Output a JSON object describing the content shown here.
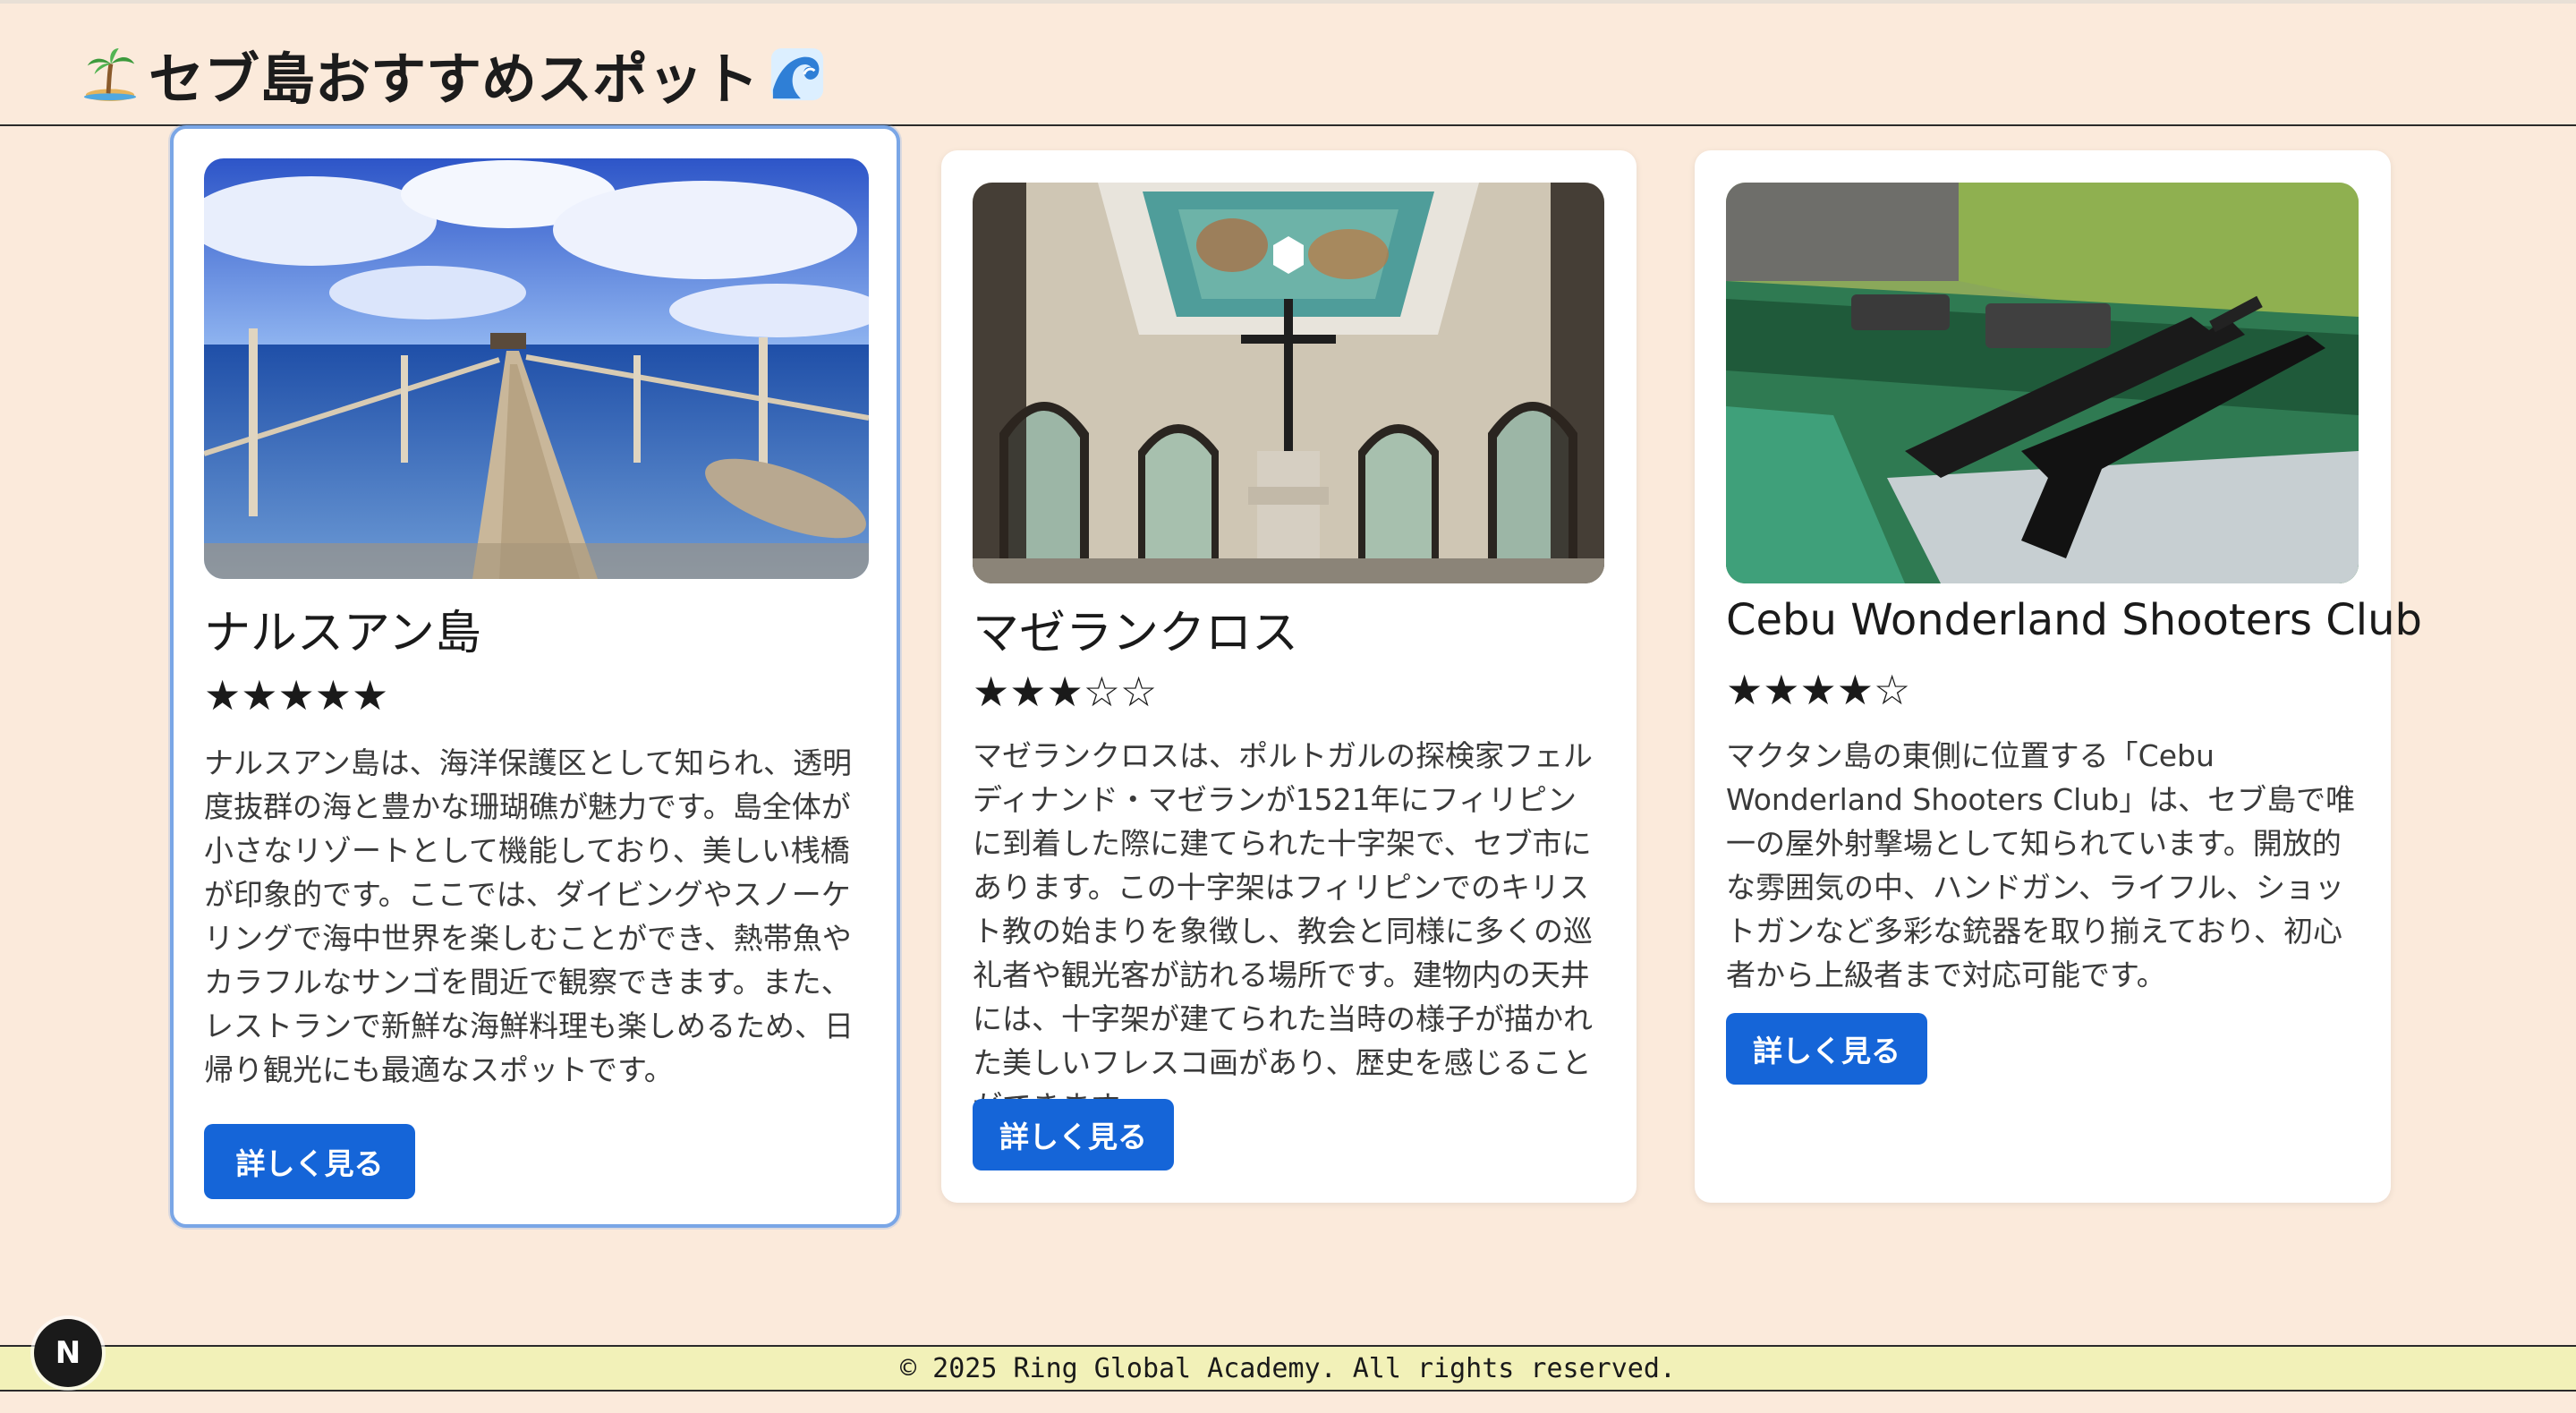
{
  "header": {
    "title": "セブ島おすすめスポット",
    "leading_icon": "palm-island-icon",
    "trailing_icon": "wave-icon"
  },
  "spots": [
    {
      "title": "ナルスアン島",
      "stars": "★★★★★",
      "rating": 5,
      "image_icon": "wooden-pier-photo",
      "description": "ナルスアン島は、海洋保護区として知られ、透明度抜群の海と豊かな珊瑚礁が魅力です。島全体が小さなリゾートとして機能しており、美しい桟橋が印象的です。ここでは、ダイビングやスノーケリングで海中世界を楽しむことができ、熱帯魚やカラフルなサンゴを間近で観察できます。また、レストランで新鮮な海鮮料理も楽しめるため、日帰り観光にも最適なスポットです。",
      "button_label": "詳しく見る"
    },
    {
      "title": "マゼランクロス",
      "stars": "★★★☆☆",
      "rating": 3,
      "image_icon": "magellan-cross-photo",
      "description": "マゼランクロスは、ポルトガルの探検家フェルディナンド・マゼランが1521年にフィリピンに到着した際に建てられた十字架で、セブ市にあります。この十字架はフィリピンでのキリスト教の始まりを象徴し、教会と同様に多くの巡礼者や観光客が訪れる場所です。建物内の天井には、十字架が建てられた当時の様子が描かれた美しいフレスコ画があり、歴史を感じることができます。",
      "button_label": "詳しく見る"
    },
    {
      "title": "Cebu Wonderland Shooters Club",
      "stars": "★★★★☆",
      "rating": 4,
      "image_icon": "shooting-range-photo",
      "description": "マクタン島の東側に位置する「Cebu Wonderland Shooters Club」は、セブ島で唯一の屋外射撃場として知られています。開放的な雰囲気の中、ハンドガン、ライフル、ショットガンなど多彩な銃器を取り揃えており、初心者から上級者まで対応可能です。",
      "button_label": "詳しく見る"
    }
  ],
  "footer": {
    "copyright": "© 2025 Ring Global Academy. All rights reserved."
  },
  "dev_badge": {
    "label": "N"
  },
  "colors": {
    "page_background": "#fbeadb",
    "button": "#1565d8",
    "footer_background": "#f2f1b8",
    "focus_ring": "#7aa6e6"
  }
}
